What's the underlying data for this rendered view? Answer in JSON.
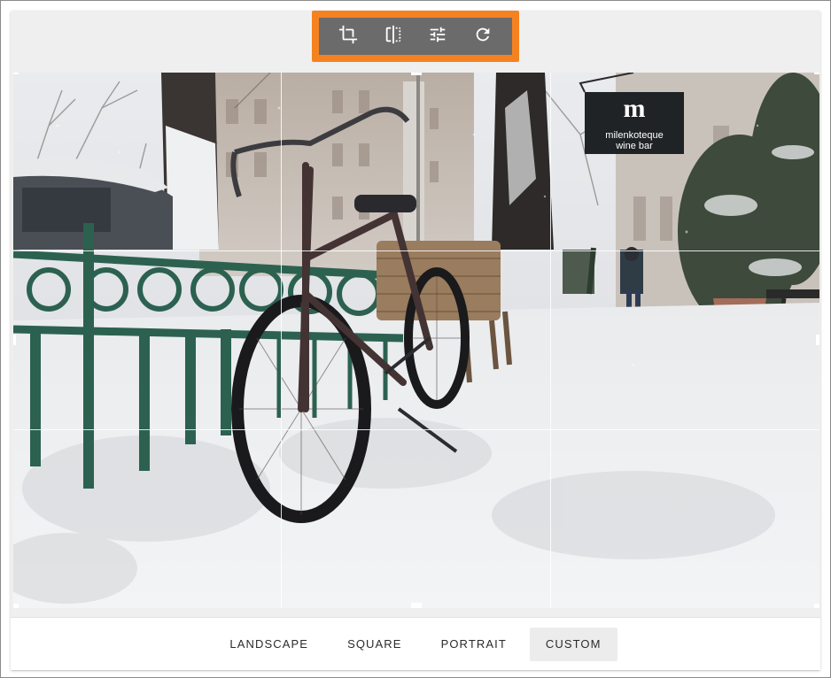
{
  "toolbar": {
    "tools": [
      {
        "name": "crop",
        "icon": "crop-icon"
      },
      {
        "name": "flip",
        "icon": "flip-icon"
      },
      {
        "name": "adjust",
        "icon": "tune-icon"
      },
      {
        "name": "rotate",
        "icon": "rotate-icon"
      }
    ],
    "highlight_color": "#f58220",
    "background_color": "#6b6b6b"
  },
  "image": {
    "sign_line1": "milenkoteque",
    "sign_line2": "wine bar"
  },
  "aspect_ratios": {
    "landscape": "LANDSCAPE",
    "square": "SQUARE",
    "portrait": "PORTRAIT",
    "custom": "CUSTOM",
    "selected": "CUSTOM"
  }
}
